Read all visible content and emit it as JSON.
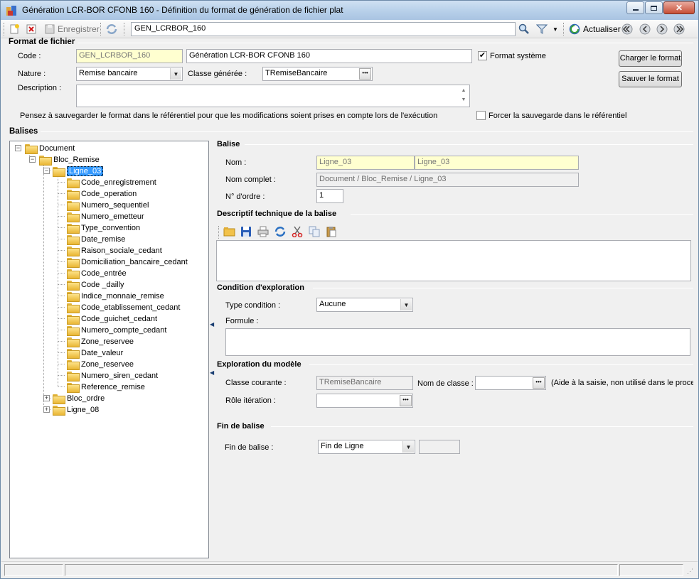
{
  "window": {
    "title": "Génération LCR-BOR CFONB 160 -  Définition du format de génération de fichier plat"
  },
  "toolbar": {
    "save_label": "Enregistrer",
    "combo_value": "GEN_LCRBOR_160",
    "refresh_label": "Actualiser"
  },
  "format_fichier": {
    "section_title": "Format de fichier",
    "code_label": "Code :",
    "code_value": "GEN_LCRBOR_160",
    "name_value": "Génération LCR-BOR CFONB 160",
    "format_systeme_label": "Format système",
    "format_systeme_checked": true,
    "nature_label": "Nature :",
    "nature_value": "Remise bancaire",
    "classe_label": "Classe générée :",
    "classe_value": "TRemiseBancaire",
    "description_label": "Description :",
    "description_value": "",
    "load_button": "Charger le format",
    "save_button": "Sauver le format",
    "note": "Pensez à sauvegarder le format dans le référentiel pour que les modifications soient prises en compte lors de l'exécution",
    "force_save_label": "Forcer la sauvegarde dans le référentiel",
    "force_save_checked": false
  },
  "balises": {
    "section_title": "Balises",
    "tree": {
      "root": "Document",
      "bloc_remise": "Bloc_Remise",
      "selected": "Ligne_03",
      "children": [
        "Code_enregistrement",
        "Code_operation",
        "Numero_sequentiel",
        "Numero_emetteur",
        "Type_convention",
        "Date_remise",
        "Raison_sociale_cedant",
        "Domiciliation_bancaire_cedant",
        "Code_entrée",
        "Code _dailly",
        "Indice_monnaie_remise",
        "Code_etablissement_cedant",
        "Code_guichet_cedant",
        "Numero_compte_cedant",
        "Zone_reservee",
        "Date_valeur",
        "Zone_reservee",
        "Numero_siren_cedant",
        "Reference_remise"
      ],
      "bloc_ordre": "Bloc_ordre",
      "ligne_08": "Ligne_08"
    }
  },
  "balise": {
    "section_title": "Balise",
    "nom_label": "Nom  :",
    "nom_value1": "Ligne_03",
    "nom_value2": "Ligne_03",
    "nom_complet_label": "Nom complet :",
    "nom_complet_value": "Document / Bloc_Remise / Ligne_03",
    "ordre_label": "N° d'ordre :",
    "ordre_value": "1"
  },
  "descriptif": {
    "section_title": "Descriptif technique de la balise"
  },
  "condition": {
    "section_title": "Condition d'exploration",
    "type_label": "Type condition :",
    "type_value": "Aucune",
    "formule_label": "Formule :"
  },
  "exploration": {
    "section_title": "Exploration du modèle",
    "classe_courante_label": "Classe courante :",
    "classe_courante_value": "TRemiseBancaire",
    "nom_classe_label": "Nom de classe :",
    "nom_classe_value": "",
    "aide_text": "(Aide à la saisie, non utilisé dans le proces",
    "role_label": "Rôle itération :",
    "role_value": ""
  },
  "fin": {
    "section_title": "Fin de balise",
    "label": "Fin de balise :",
    "value": "Fin de Ligne"
  }
}
